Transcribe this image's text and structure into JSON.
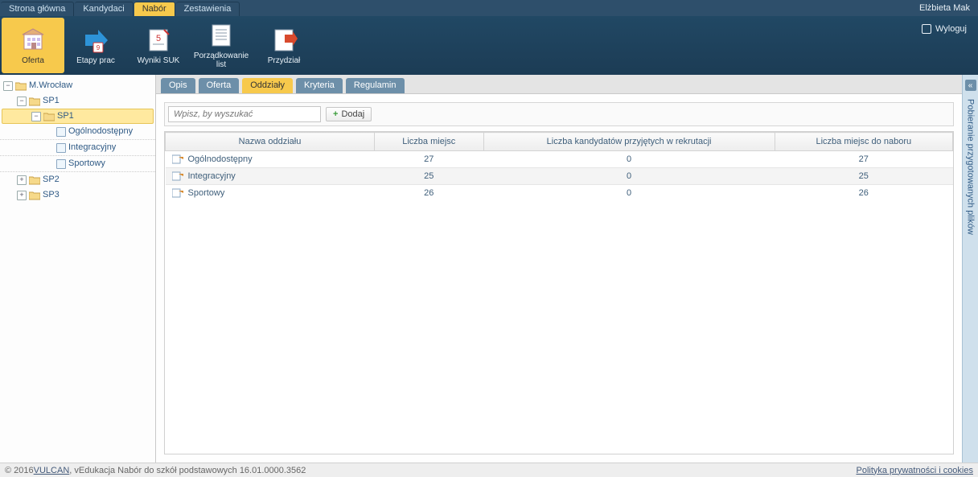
{
  "topnav": {
    "tabs": [
      {
        "label": "Strona główna"
      },
      {
        "label": "Kandydaci"
      },
      {
        "label": "Nabór"
      },
      {
        "label": "Zestawienia"
      }
    ],
    "active": 2,
    "user": "Elżbieta Mak"
  },
  "logout": {
    "label": "Wyloguj"
  },
  "ribbon": {
    "items": [
      {
        "label": "Oferta",
        "icon": "building"
      },
      {
        "label": "Etapy prac",
        "icon": "arrow"
      },
      {
        "label": "Wyniki SUK",
        "icon": "sheet"
      },
      {
        "label": "Porządkowanie list",
        "icon": "list"
      },
      {
        "label": "Przydział",
        "icon": "assign"
      }
    ],
    "active": 0
  },
  "tree": {
    "root": {
      "label": "M.Wrocław"
    },
    "sp1": {
      "label": "SP1"
    },
    "subsp1": {
      "label": "SP1"
    },
    "dept1": {
      "label": "Ogólnodostępny"
    },
    "dept2": {
      "label": "Integracyjny"
    },
    "dept3": {
      "label": "Sportowy"
    },
    "sp2": {
      "label": "SP2"
    },
    "sp3": {
      "label": "SP3"
    }
  },
  "detailTabs": {
    "items": [
      {
        "label": "Opis"
      },
      {
        "label": "Oferta"
      },
      {
        "label": "Oddziały"
      },
      {
        "label": "Kryteria"
      },
      {
        "label": "Regulamin"
      }
    ],
    "active": 2
  },
  "toolbar": {
    "search_placeholder": "Wpisz, by wyszukać",
    "add_label": "Dodaj"
  },
  "grid": {
    "headers": [
      "Nazwa oddziału",
      "Liczba miejsc",
      "Liczba kandydatów przyjętych w rekrutacji",
      "Liczba miejsc do naboru"
    ],
    "rows": [
      {
        "name": "Ogólnodostępny",
        "places": "27",
        "accepted": "0",
        "avail": "27"
      },
      {
        "name": "Integracyjny",
        "places": "25",
        "accepted": "0",
        "avail": "25"
      },
      {
        "name": "Sportowy",
        "places": "26",
        "accepted": "0",
        "avail": "26"
      }
    ]
  },
  "sidepanel": {
    "label": "Pobieranie przygotowanych plików"
  },
  "footer": {
    "copyright": "© 2016 ",
    "vendor": "VULCAN",
    "product": ", vEdukacja Nabór do szkół podstawowych 16.01.0000.3562",
    "privacy": "Polityka prywatności i cookies"
  }
}
